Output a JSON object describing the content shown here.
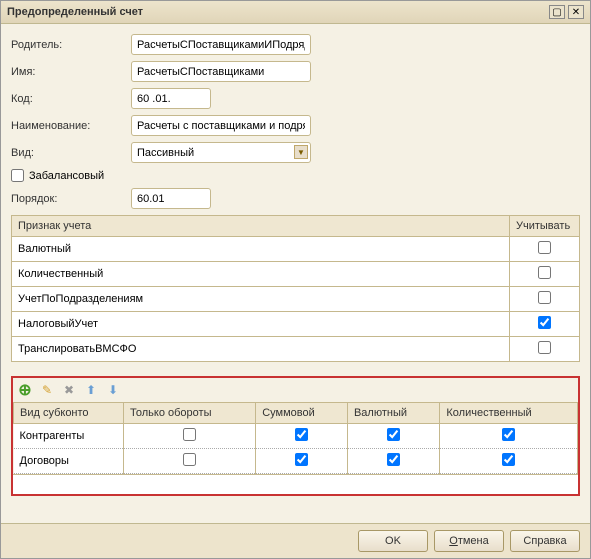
{
  "title": "Предопределенный счет",
  "form": {
    "parent_label": "Родитель:",
    "parent_value": "РасчетыСПоставщикамиИПодрядчик",
    "name_label": "Имя:",
    "name_value": "РасчетыСПоставщиками",
    "code_label": "Код:",
    "code_value": "60 .01.",
    "descr_label": "Наименование:",
    "descr_value": "Расчеты с поставщиками и подрядчи",
    "type_label": "Вид:",
    "type_value": "Пассивный",
    "offbalance_label": "Забалансовый",
    "order_label": "Порядок:",
    "order_value": "60.01"
  },
  "attr_table": {
    "col1": "Признак учета",
    "col2": "Учитывать",
    "rows": [
      {
        "label": "Валютный",
        "checked": false
      },
      {
        "label": "Количественный",
        "checked": false
      },
      {
        "label": "УчетПоПодразделениям",
        "checked": false
      },
      {
        "label": "НалоговыйУчет",
        "checked": true
      },
      {
        "label": "ТранслироватьВМСФО",
        "checked": false
      }
    ]
  },
  "subkonto": {
    "cols": {
      "kind": "Вид субконто",
      "only_turnovers": "Только обороты",
      "sum": "Суммовой",
      "currency": "Валютный",
      "qty": "Количественный"
    },
    "rows": [
      {
        "kind": "Контрагенты",
        "only": false,
        "sum": true,
        "cur": true,
        "qty": true
      },
      {
        "kind": "Договоры",
        "only": false,
        "sum": true,
        "cur": true,
        "qty": true
      }
    ]
  },
  "footer": {
    "ok": "OK",
    "cancel": "Отмена",
    "help": "Справка"
  }
}
